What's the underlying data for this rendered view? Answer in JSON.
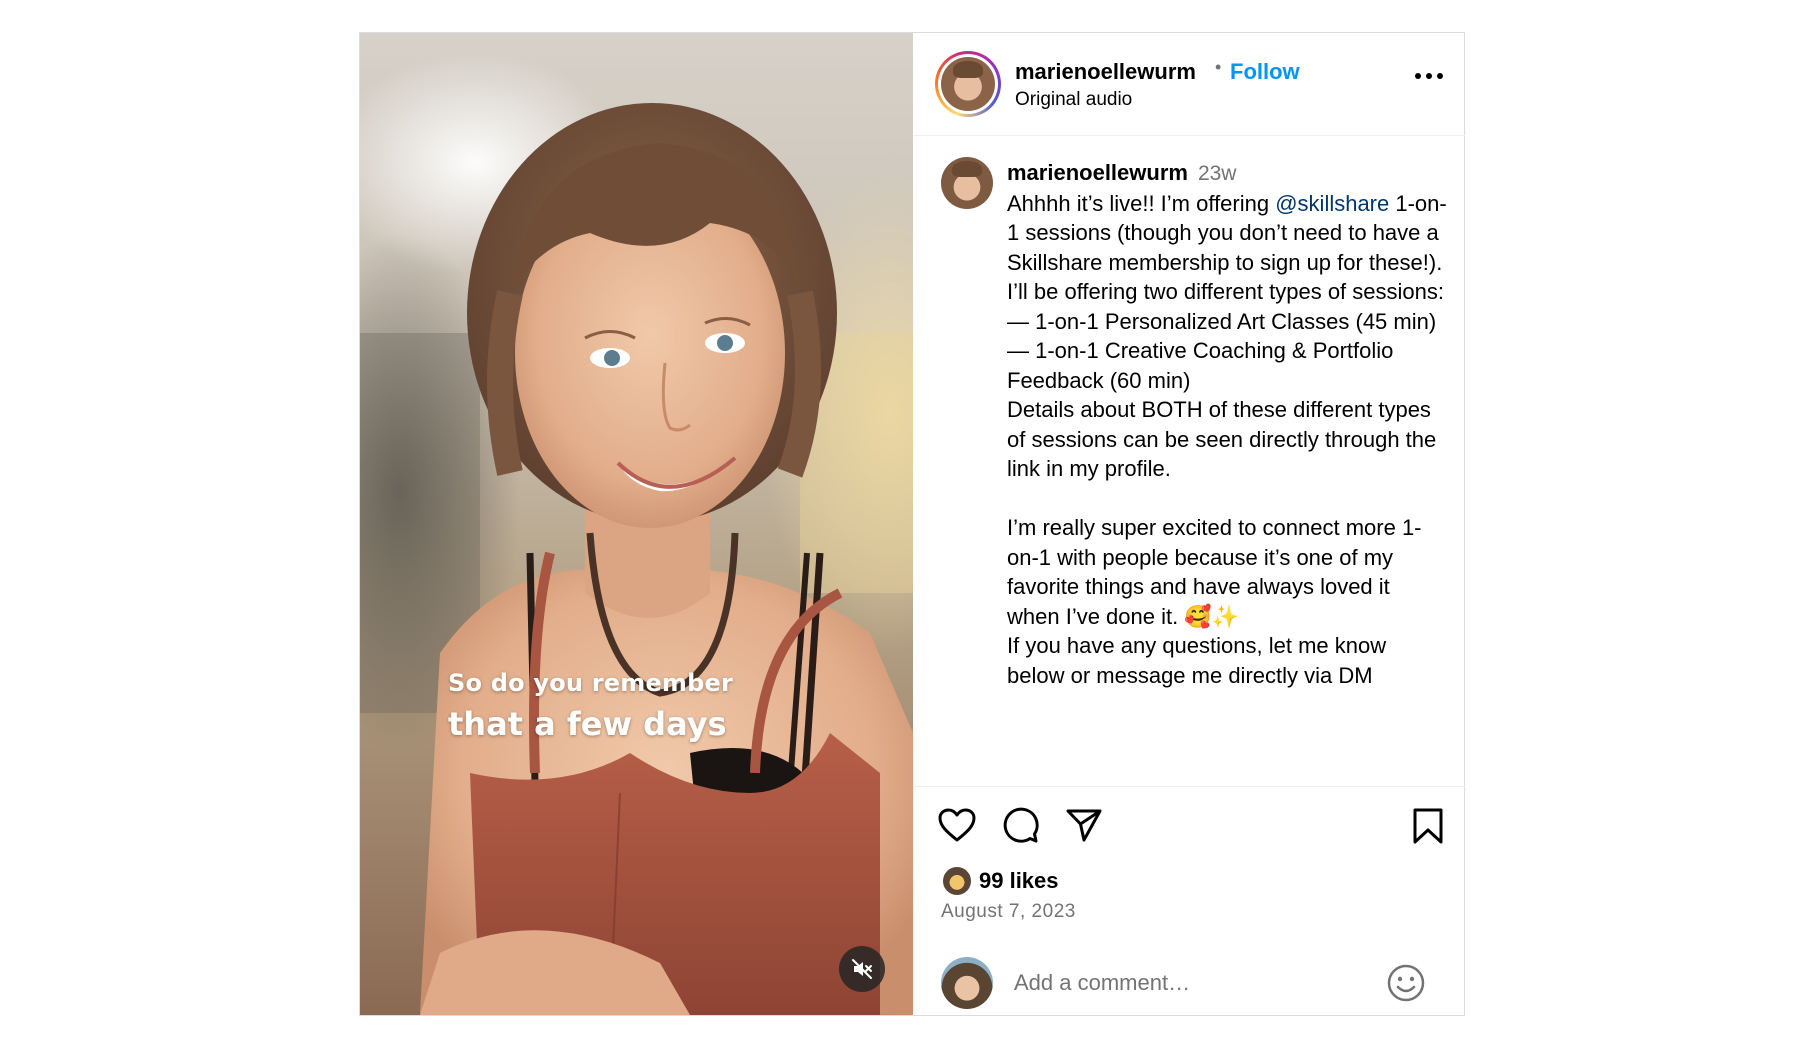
{
  "video": {
    "overlay_line1": "So do you remember",
    "overlay_line2": "that a few days",
    "mute_icon": "speaker-muted-icon"
  },
  "header": {
    "username": "marienoellewurm",
    "separator": "•",
    "follow_label": "Follow",
    "audio_label": "Original audio",
    "more_icon": "more-horizontal-icon"
  },
  "caption": {
    "username": "marienoellewurm",
    "time_ago": "23w",
    "text_before_mention": "Ahhhh it’s live!! I’m offering ",
    "mention": "@skillshare",
    "text_after_mention": " 1-on-1 sessions (though you don’t need to have a Skillshare membership to sign up for these!).",
    "paragraph2": "I’ll be offering two different types of sessions:\n— 1-on-1 Personalized Art Classes (45 min)\n— 1-on-1 Creative Coaching & Portfolio Feedback (60 min)\nDetails about BOTH of these different types of sessions can be seen directly through the link in my profile.",
    "paragraph3": "I’m really super excited to connect more 1-on-1 with people because it’s one of my favorite things and have always loved it when I’ve done it. 🥰✨",
    "paragraph4": "If you have any questions, let me know below or message me directly via DM"
  },
  "actions": {
    "like_icon": "heart-icon",
    "comment_icon": "comment-bubble-icon",
    "share_icon": "paper-plane-icon",
    "save_icon": "bookmark-icon"
  },
  "likes": {
    "count_label": "99 likes"
  },
  "date": "August 7, 2023",
  "comment_box": {
    "placeholder": "Add a comment…",
    "emoji_icon": "smiley-icon"
  }
}
